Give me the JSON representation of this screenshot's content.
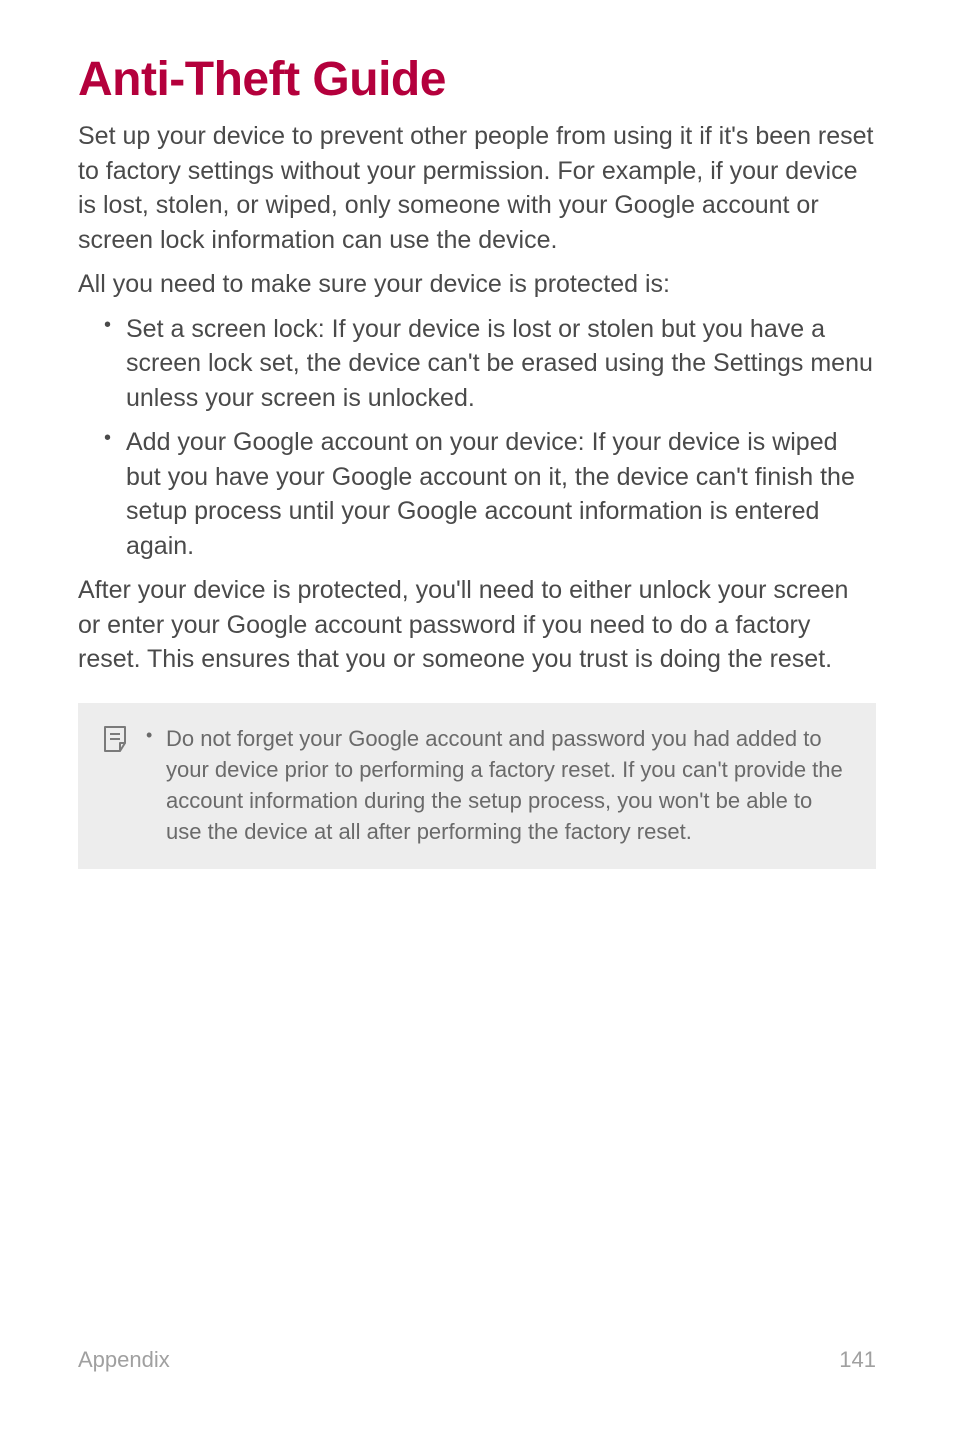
{
  "title": "Anti-Theft Guide",
  "para1": "Set up your device to prevent other people from using it if it's been reset to factory settings without your permission. For example, if your device is lost, stolen, or wiped, only someone with your Google account or screen lock information can use the device.",
  "para2": "All you need to make sure your device is protected is:",
  "bullets": {
    "b1": "Set a screen lock: If your device is lost or stolen but you have a screen lock set, the device can't be erased using the Settings menu unless your screen is unlocked.",
    "b2": "Add your Google account on your device: If your device is wiped but you have your Google account on it, the device can't finish the setup process until your Google account information is entered again."
  },
  "para3": "After your device is protected, you'll need to either unlock your screen or enter your Google account password if you need to do a factory reset. This ensures that you or someone you trust is doing the reset.",
  "note": {
    "n1": "Do not forget your Google account and password you had added to your device prior to performing a factory reset. If you can't provide the account information during the setup process, you won't be able to use the device at all after performing the factory reset."
  },
  "footer": {
    "section": "Appendix",
    "page": "141"
  }
}
